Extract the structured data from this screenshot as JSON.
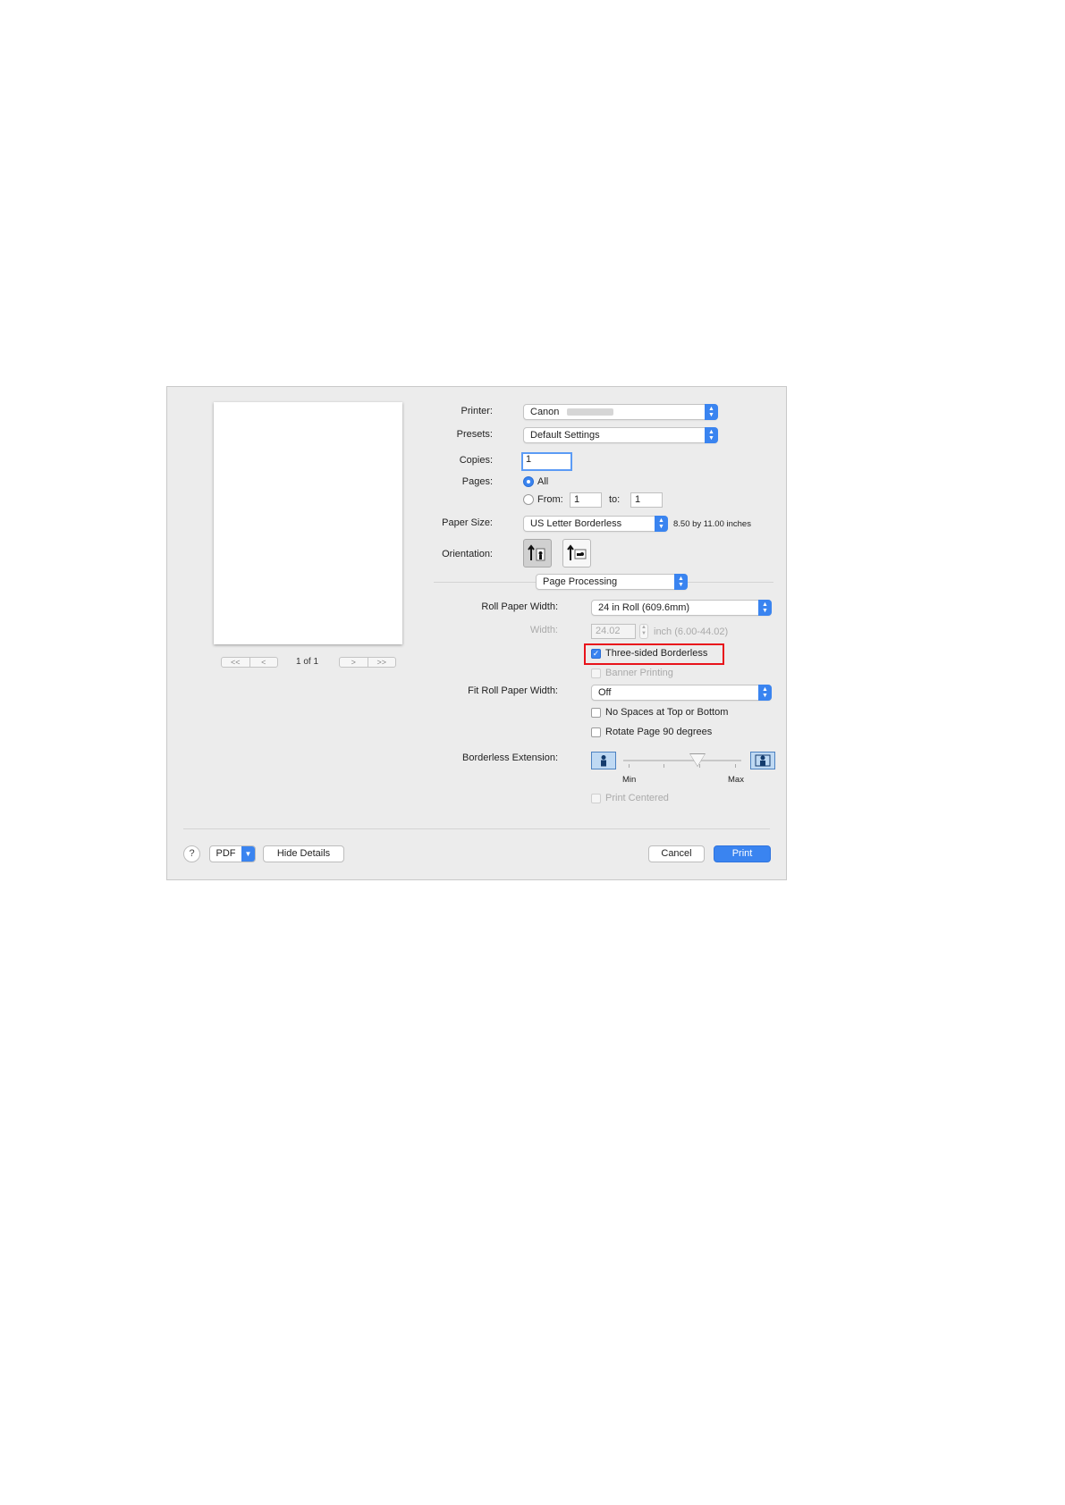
{
  "preview": {
    "page_label": "1 of 1",
    "nav_first": "<<",
    "nav_prev": "<",
    "nav_next": ">",
    "nav_last": ">>"
  },
  "printer": {
    "label": "Printer:",
    "value": "Canon"
  },
  "presets": {
    "label": "Presets:",
    "value": "Default Settings"
  },
  "copies": {
    "label": "Copies:",
    "value": "1"
  },
  "pages": {
    "label": "Pages:",
    "all_label": "All",
    "all_selected": true,
    "from_label": "From:",
    "from_value": "1",
    "to_label": "to:",
    "to_value": "1"
  },
  "paper_size": {
    "label": "Paper Size:",
    "value": "US Letter Borderless",
    "dimensions": "8.50 by 11.00 inches"
  },
  "orientation": {
    "label": "Orientation:",
    "selected": "portrait"
  },
  "section_popup": {
    "value": "Page Processing"
  },
  "roll_paper_width": {
    "label": "Roll Paper Width:",
    "value": "24 in Roll (609.6mm)"
  },
  "width": {
    "label": "Width:",
    "value": "24.02",
    "unit_range": "inch (6.00-44.02)"
  },
  "three_sided_borderless": {
    "label": "Three-sided Borderless",
    "checked": true
  },
  "banner_printing": {
    "label": "Banner Printing",
    "checked": false,
    "enabled": false
  },
  "fit_roll_paper_width": {
    "label": "Fit Roll Paper Width:",
    "value": "Off"
  },
  "no_spaces": {
    "label": "No Spaces at Top or Bottom",
    "checked": false
  },
  "rotate_page": {
    "label": "Rotate Page 90 degrees",
    "checked": false
  },
  "borderless_extension": {
    "label": "Borderless Extension:",
    "min_label": "Min",
    "max_label": "Max",
    "level": 0.65
  },
  "print_centered": {
    "label": "Print Centered",
    "checked": false,
    "enabled": false
  },
  "footer": {
    "help_label": "?",
    "pdf_label": "PDF",
    "hide_details_label": "Hide Details",
    "cancel_label": "Cancel",
    "print_label": "Print"
  },
  "colors": {
    "accent": "#3a84f0",
    "highlight": "#e8131b",
    "dialog_bg": "#ececec"
  }
}
